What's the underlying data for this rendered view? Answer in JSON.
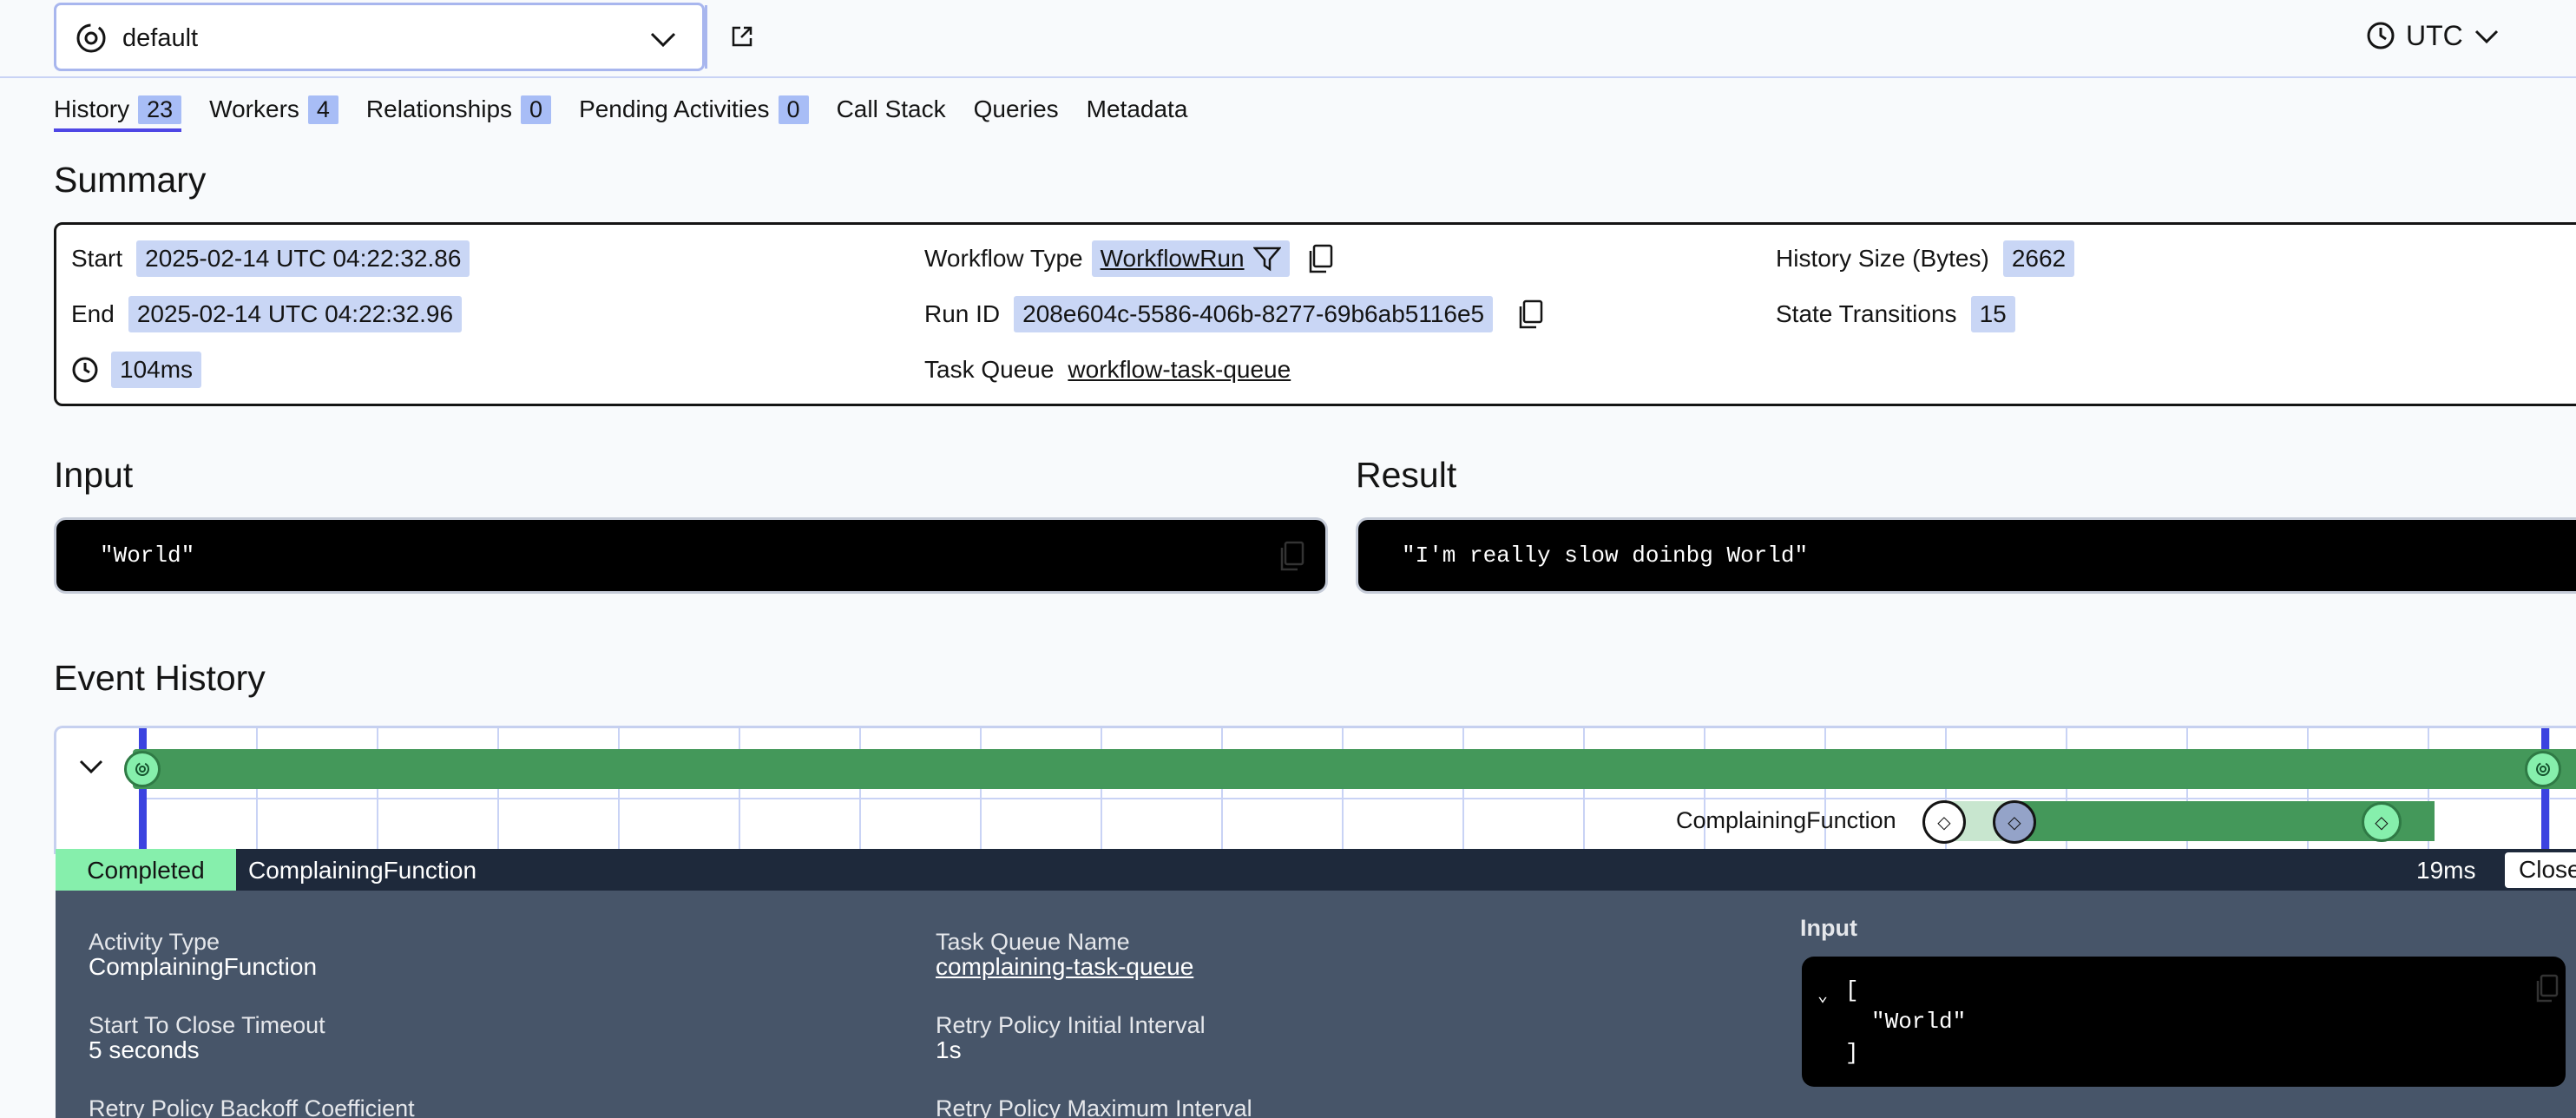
{
  "namespace": {
    "value": "default"
  },
  "timezone": {
    "label": "UTC"
  },
  "tabs": [
    {
      "label": "History",
      "count": "23"
    },
    {
      "label": "Workers",
      "count": "4"
    },
    {
      "label": "Relationships",
      "count": "0"
    },
    {
      "label": "Pending Activities",
      "count": "0"
    },
    {
      "label": "Call Stack"
    },
    {
      "label": "Queries"
    },
    {
      "label": "Metadata"
    }
  ],
  "summary": {
    "title": "Summary",
    "start_label": "Start",
    "start_value": "2025-02-14 UTC 04:22:32.86",
    "end_label": "End",
    "end_value": "2025-02-14 UTC 04:22:32.96",
    "duration": "104ms",
    "workflow_type_label": "Workflow Type",
    "workflow_type_value": "WorkflowRun",
    "run_id_label": "Run ID",
    "run_id_value": "208e604c-5586-406b-8277-69b6ab5116e5",
    "task_queue_label": "Task Queue",
    "task_queue_value": "workflow-task-queue",
    "history_size_label": "History Size (Bytes)",
    "history_size_value": "2662",
    "state_transitions_label": "State Transitions",
    "state_transitions_value": "15"
  },
  "input": {
    "title": "Input",
    "value": "\"World\""
  },
  "result": {
    "title": "Result",
    "value": "\"I'm really slow doinbg World\""
  },
  "event_history": {
    "title": "Event History",
    "activity_label": "ComplainingFunction",
    "status": "Completed",
    "status_name": "ComplainingFunction",
    "duration": "19ms",
    "close_label": "Close",
    "colors": {
      "green": "#44985a",
      "light_green": "#86efac",
      "blue_marker": "#3b43e0"
    }
  },
  "detail": {
    "activity_type_label": "Activity Type",
    "activity_type_value": "ComplainingFunction",
    "start_to_close_label": "Start To Close Timeout",
    "start_to_close_value": "5 seconds",
    "backoff_label": "Retry Policy Backoff Coefficient",
    "task_queue_name_label": "Task Queue Name",
    "task_queue_name_value": "complaining-task-queue",
    "initial_interval_label": "Retry Policy Initial Interval",
    "initial_interval_value": "1s",
    "max_interval_label": "Retry Policy Maximum Interval",
    "input_label": "Input",
    "input_line1": "[",
    "input_line2": "\"World\"",
    "input_line3": "]"
  }
}
